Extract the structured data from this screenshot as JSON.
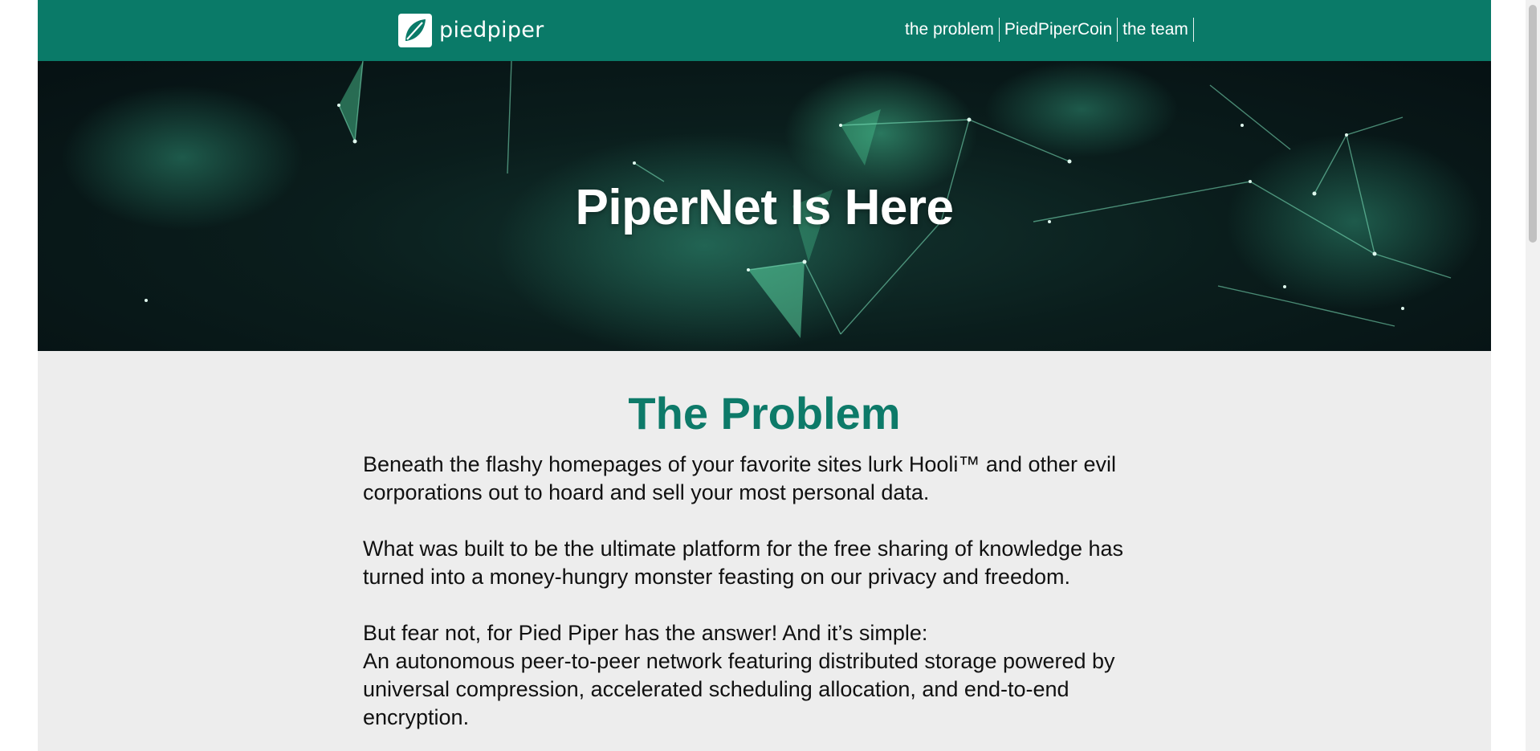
{
  "header": {
    "logo_text": "piedpiper",
    "logo_icon": "leaf-icon",
    "nav": [
      {
        "label": "the problem"
      },
      {
        "label": "PiedPiperCoin"
      },
      {
        "label": "the team"
      }
    ]
  },
  "hero": {
    "title": "PiperNet Is Here"
  },
  "problem": {
    "title": "The Problem",
    "paragraphs": [
      "Beneath the flashy homepages of your favorite sites lurk Hooli™ and other evil corporations out to hoard and sell your most personal data.",
      "What was built to be the ultimate platform for the free sharing of knowledge has turned into a money-hungry monster feasting on our privacy and freedom.",
      "But fear not, for Pied Piper has the answer! And it’s simple:",
      "An autonomous peer-to-peer network featuring distributed storage powered by universal compression, accelerated scheduling allocation, and end-to-end encryption."
    ]
  },
  "colors": {
    "brand": "#0a7a68",
    "title_green": "#0d7a69",
    "background": "#ededed"
  }
}
